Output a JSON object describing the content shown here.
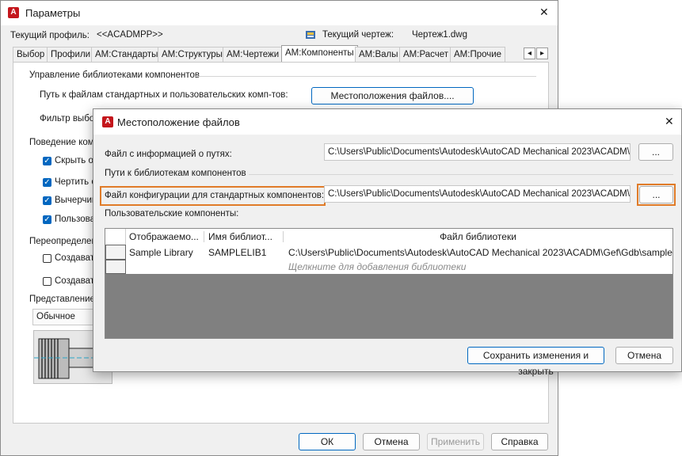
{
  "colors": {
    "accent": "#0067c0",
    "highlight": "#e07b28",
    "app_icon": "#c4161c",
    "grid_empty": "#808080"
  },
  "main": {
    "icon_letter": "A",
    "title": "Параметры",
    "close_glyph": "✕",
    "current_profile_label": "Текущий профиль:",
    "current_profile_value": "<<ACADMPP>>",
    "current_drawing_label": "Текущий чертеж:",
    "current_drawing_value": "Чертеж1.dwg",
    "tabs": [
      "Выбор",
      "Профили",
      "АМ:Стандарты",
      "АМ:Структуры",
      "АМ:Чертежи",
      "АМ:Компоненты",
      "АМ:Валы",
      "АМ:Расчет",
      "АМ:Прочие"
    ],
    "tab_scroll_left": "◂",
    "tab_scroll_right": "▸",
    "library_group": "Управление библиотеками компонентов",
    "paths_label": "Путь к файлам стандартных и пользовательских комп-тов:",
    "file_locations_button": "Местоположения файлов....",
    "filter_label": "Фильтр выбо",
    "behavior_group": "Поведение комп",
    "behavior_options": [
      "Скрыть об",
      "Чертить с",
      "Вычерчив",
      "Пользоват"
    ],
    "override_group": "Переопределен",
    "override_options": [
      "Создават",
      "Создават"
    ],
    "representation_group": "Представление",
    "representation_value": "Обычное",
    "ok_button": "ОК",
    "cancel_button": "Отмена",
    "apply_button": "Применить",
    "help_button": "Справка"
  },
  "dialog": {
    "icon_letter": "A",
    "title": "Местоположение файлов",
    "close_glyph": "✕",
    "path_info_label": "Файл с информацией о путях:",
    "path_info_value": "C:\\Users\\Public\\Documents\\Autodesk\\AutoCAD Mechanical 2023\\ACADM\\Gef\\Gdb\\",
    "browse_label": "...",
    "component_paths_group": "Пути к библиотекам компонентов",
    "std_config_label": "Файл конфигурации для стандартных компонентов:",
    "std_config_value": "C:\\Users\\Public\\Documents\\Autodesk\\AutoCAD Mechanical 2023\\ACADM\\Gef\\Gdb\\",
    "user_components_label": "Пользовательские компоненты:",
    "table": {
      "columns": [
        "",
        "Отображаемо...",
        "Имя библиот...",
        "Файл библиотеки"
      ],
      "rows": [
        [
          "",
          "Sample Library",
          "SAMPLELIB1",
          "C:\\Users\\Public\\Documents\\Autodesk\\AutoCAD Mechanical 2023\\ACADM\\Gef\\Gdb\\sample"
        ]
      ],
      "add_hint": "Щелкните для добавления библиотеки"
    },
    "save_close_button": "Сохранить изменения и закрыть",
    "cancel_button": "Отмена"
  }
}
